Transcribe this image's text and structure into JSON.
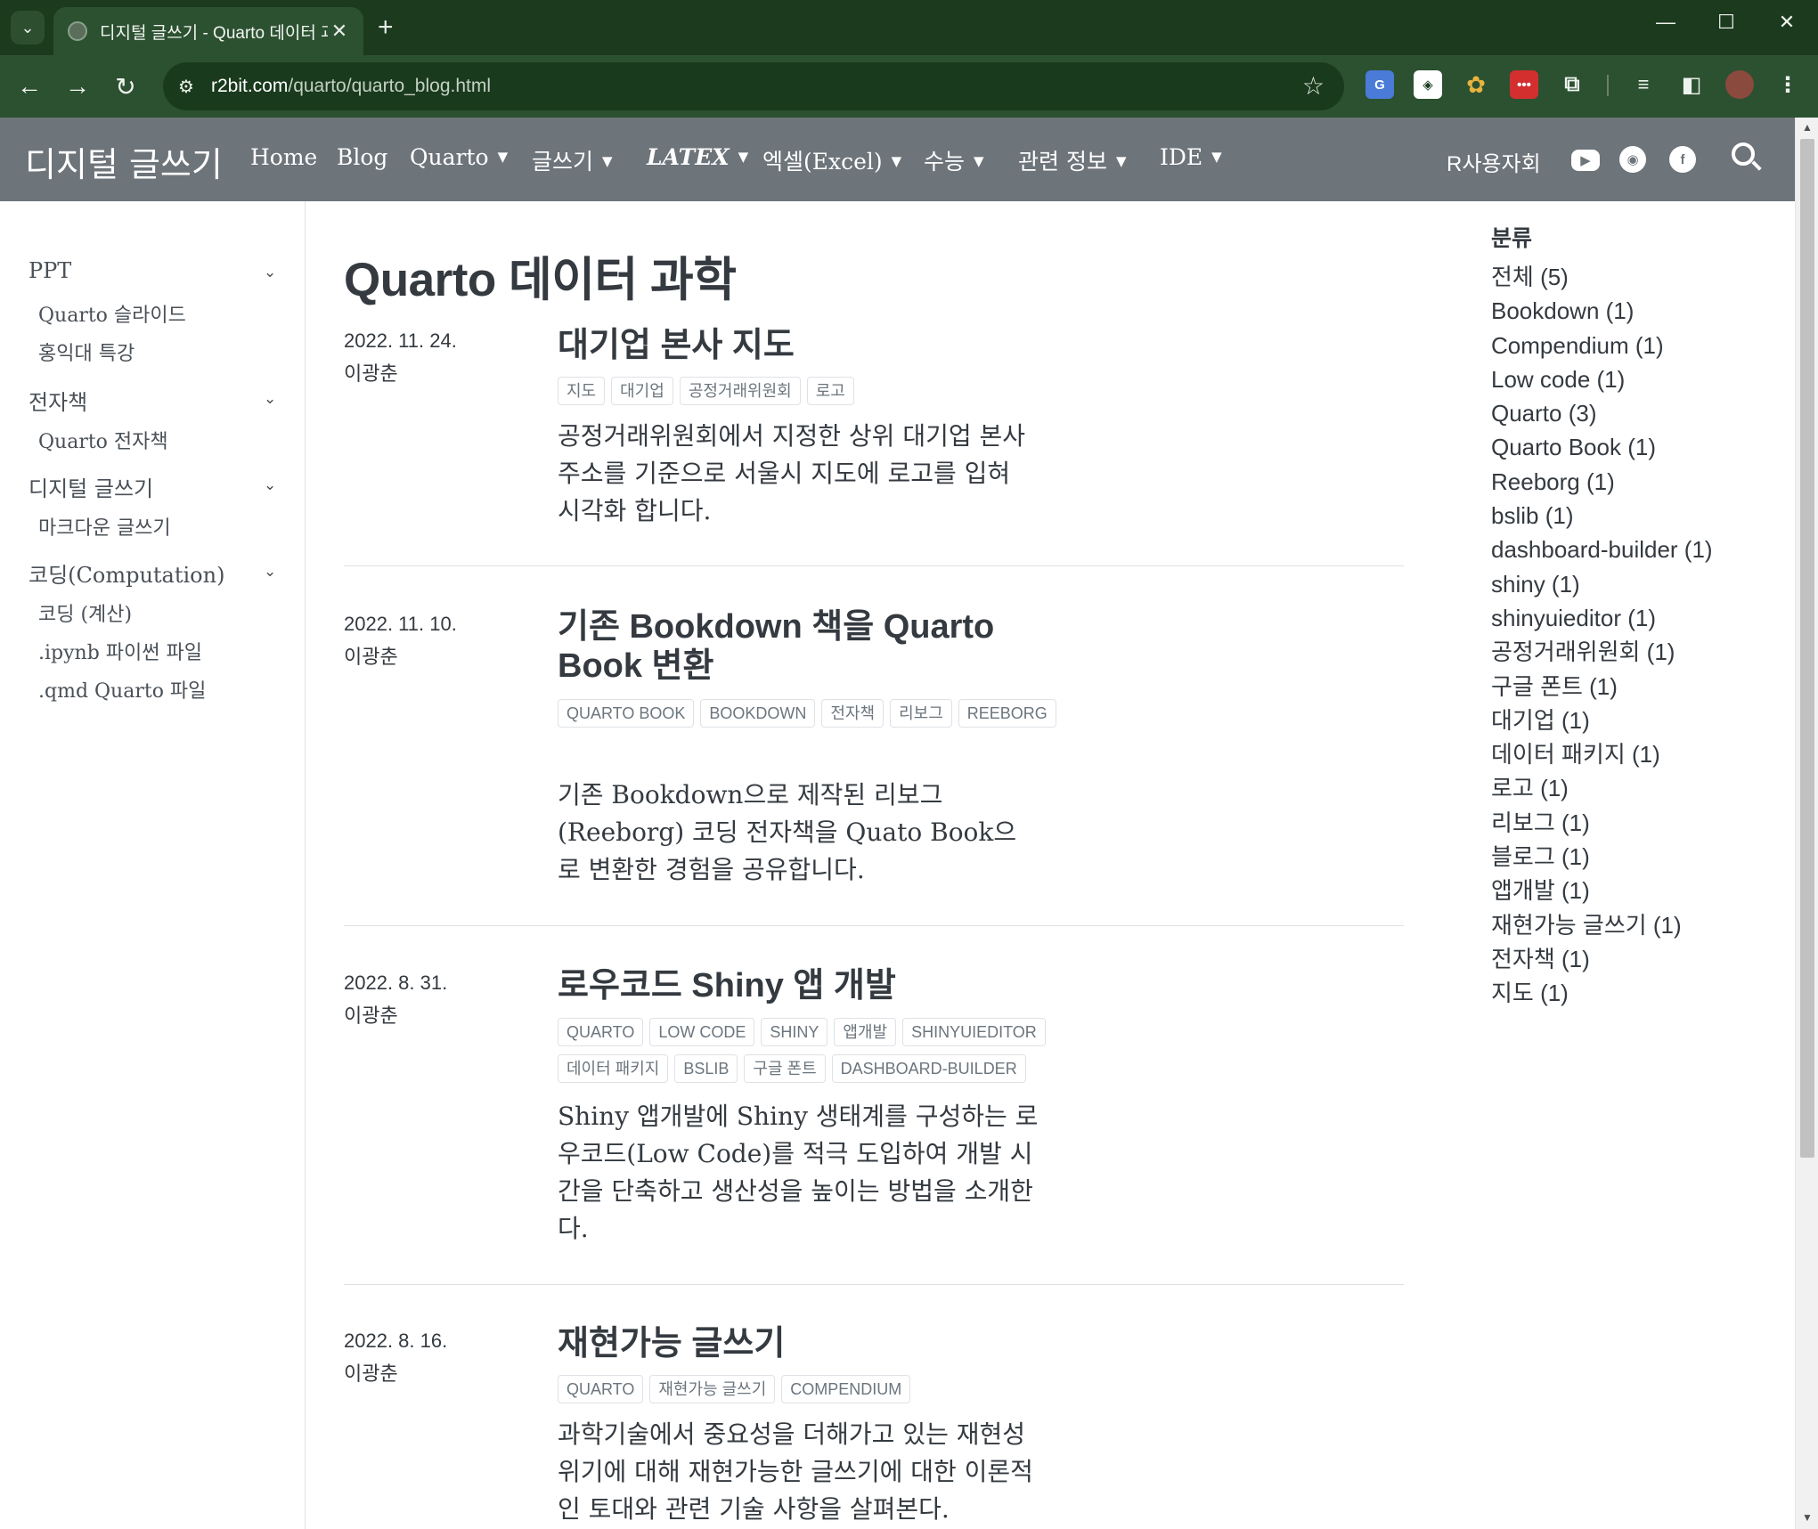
{
  "browser": {
    "tab_title": "디지털 글쓰기 - Quarto 데이터 과학",
    "url_host": "r2bit.com",
    "url_path": "/quarto/quarto_blog.html",
    "extensions": [
      {
        "name": "google-translate-icon",
        "color": "#4a7bd8",
        "glyph": "G"
      },
      {
        "name": "perplexity-icon",
        "color": "#ffffff",
        "glyph": "◈"
      },
      {
        "name": "color-picker-icon",
        "color": "#e04a4a",
        "glyph": "✿"
      },
      {
        "name": "lastpass-icon",
        "color": "#d32f2f",
        "glyph": "•••"
      }
    ]
  },
  "navbar": {
    "brand": "디지털 글쓰기",
    "items": [
      {
        "label": "Home"
      },
      {
        "label": "Blog"
      },
      {
        "label": "Quarto"
      },
      {
        "label": "글쓰기"
      },
      {
        "label": "LATEX"
      },
      {
        "label": "엑셀(Excel)"
      },
      {
        "label": "수능"
      },
      {
        "label": "관련 정보"
      },
      {
        "label": "IDE"
      }
    ],
    "user_group": "R사용자회"
  },
  "sidebar": {
    "sections": [
      {
        "title": "PPT",
        "items": [
          "Quarto 슬라이드",
          "홍익대 특강"
        ]
      },
      {
        "title": "전자책",
        "items": [
          "Quarto 전자책"
        ]
      },
      {
        "title": "디지털 글쓰기",
        "items": [
          "마크다운 글쓰기"
        ]
      },
      {
        "title": "코딩(Computation)",
        "items": [
          "코딩 (계산)",
          ".ipynb 파이썬 파일",
          ".qmd Quarto 파일"
        ]
      }
    ]
  },
  "main": {
    "title": "Quarto 데이터 과학",
    "posts": [
      {
        "date": "2022. 11. 24.",
        "author": "이광춘",
        "title": "대기업 본사 지도",
        "tags": [
          "지도",
          "대기업",
          "공정거래위원회",
          "로고"
        ],
        "description": "공정거래위원회에서 지정한 상위 대기업 본사 주소를 기준으로 서울시 지도에 로고를 입혀 시각화 합니다."
      },
      {
        "date": "2022. 11. 10.",
        "author": "이광춘",
        "title": "기존 Bookdown 책을 Quarto Book 변환",
        "tags": [
          "QUARTO BOOK",
          "BOOKDOWN",
          "전자책",
          "리보그",
          "REEBORG"
        ],
        "description": "기존 Bookdown으로 제작된 리보그(Reeborg) 코딩 전자책을 Quato Book으로 변환한 경험을 공유합니다."
      },
      {
        "date": "2022. 8. 31.",
        "author": "이광춘",
        "title": "로우코드 Shiny 앱 개발",
        "tags": [
          "QUARTO",
          "LOW CODE",
          "SHINY",
          "앱개발",
          "SHINYUIEDITOR",
          "데이터 패키지",
          "BSLIB",
          "구글 폰트",
          "DASHBOARD-BUILDER"
        ],
        "description": "Shiny 앱개발에 Shiny 생태계를 구성하는 로우코드(Low Code)를 적극 도입하여 개발 시간을 단축하고 생산성을 높이는 방법을 소개한다."
      },
      {
        "date": "2022. 8. 16.",
        "author": "이광춘",
        "title": "재현가능 글쓰기",
        "tags": [
          "QUARTO",
          "재현가능 글쓰기",
          "COMPENDIUM"
        ],
        "description": "과학기술에서 중요성을 더해가고 있는 재현성 위기에 대해 재현가능한 글쓰기에 대한 이론적인 토대와 관련 기술 사항을 살펴본다."
      }
    ]
  },
  "categories": {
    "title": "분류",
    "items": [
      "전체 (5)",
      "Bookdown (1)",
      "Compendium (1)",
      "Low code (1)",
      "Quarto (3)",
      "Quarto Book (1)",
      "Reeborg (1)",
      "bslib (1)",
      "dashboard-builder (1)",
      "shiny (1)",
      "shinyuieditor (1)",
      "공정거래위원회 (1)",
      "구글 폰트 (1)",
      "대기업 (1)",
      "데이터 패키지 (1)",
      "로고 (1)",
      "리보그 (1)",
      "블로그 (1)",
      "앱개발 (1)",
      "재현가능 글쓰기 (1)",
      "전자책 (1)",
      "지도 (1)"
    ]
  }
}
